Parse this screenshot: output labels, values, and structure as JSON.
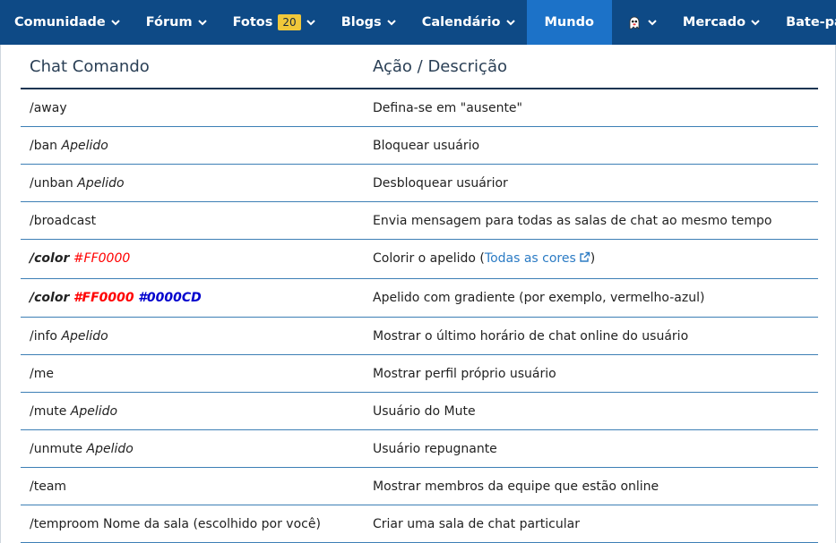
{
  "nav": {
    "items": [
      {
        "label": "Comunidade",
        "chevron": true
      },
      {
        "label": "Fórum",
        "chevron": true
      },
      {
        "label": "Fotos",
        "badge": "20",
        "chevron": true
      },
      {
        "label": "Blogs",
        "chevron": true
      },
      {
        "label": "Calendário",
        "chevron": true
      },
      {
        "label": "Mundo",
        "active": true
      },
      {
        "label": "",
        "icon": "ghost-icon",
        "chevron": true
      },
      {
        "label": "Mercado",
        "chevron": true
      },
      {
        "label": "Bate-papo"
      }
    ]
  },
  "table": {
    "header_cmd": "Chat Comando",
    "header_desc": "Ação / Descrição",
    "rows": [
      {
        "cmd": "/away",
        "arg": "",
        "desc": "Defina-se em \"ausente\""
      },
      {
        "cmd": "/ban",
        "arg": "Apelido",
        "desc": "Bloquear usuário"
      },
      {
        "cmd": "/unban",
        "arg": "Apelido",
        "desc": "Desbloquear usuárior"
      },
      {
        "cmd": "/broadcast",
        "arg": "",
        "desc": "Envia mensagem para todas as salas de chat ao mesmo tempo"
      },
      {
        "cmd": "/color",
        "arg": "#FF0000",
        "desc_prefix": "Colorir o apelido (",
        "link": "Todas as cores",
        "desc_suffix": ")"
      },
      {
        "cmd": "/color",
        "arg": "#FF0000",
        "arg2": "#0000CD",
        "desc": "Apelido com gradiente (por exemplo, vermelho-azul)"
      },
      {
        "cmd": "/info",
        "arg": "Apelido",
        "desc": "Mostrar o último horário de chat online do usuário"
      },
      {
        "cmd": "/me",
        "arg": "",
        "desc": "Mostrar perfil próprio usuário"
      },
      {
        "cmd": "/mute",
        "arg": "Apelido",
        "desc": "Usuário do Mute"
      },
      {
        "cmd": "/unmute",
        "arg": "Apelido",
        "desc": "Usuário repugnante"
      },
      {
        "cmd": "/team",
        "arg": "",
        "desc": "Mostrar membros da equipe que estão online"
      },
      {
        "cmd": "/temproom",
        "arg": "Nome da sala (escolhido por você)",
        "desc": "Criar uma sala de chat particular"
      }
    ]
  },
  "colors": {
    "nav_bg": "#0e4a86",
    "nav_active": "#1c72c8",
    "badge": "#f0c83a",
    "red": "#ff0000",
    "blue": "#0000cd",
    "link": "#2b7bc4"
  }
}
